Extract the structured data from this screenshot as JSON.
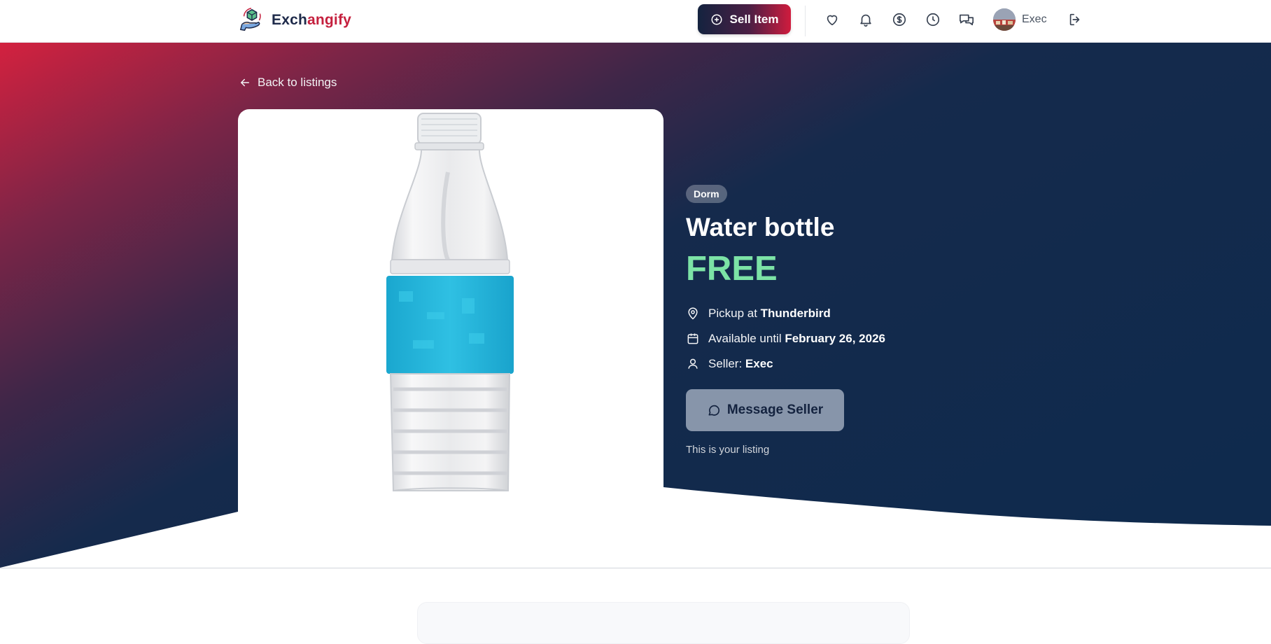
{
  "header": {
    "brand": {
      "part1": "Exch",
      "part2": "angify",
      "logo_icon": "hand-box-icon"
    },
    "sell_button": {
      "label": "Sell Item",
      "icon": "plus-circle-icon"
    },
    "nav_icons": [
      "heart-icon",
      "bell-icon",
      "dollar-icon",
      "clock-icon",
      "chat-icon"
    ],
    "user": {
      "name": "Exec"
    },
    "logout_icon": "logout-icon"
  },
  "back_link": {
    "label": "Back to listings",
    "icon": "arrow-left-icon"
  },
  "listing": {
    "category": "Dorm",
    "title": "Water bottle",
    "price": "FREE",
    "pickup_prefix": "Pickup at ",
    "pickup_location": "Thunderbird",
    "available_prefix": "Available until ",
    "available_date": "February 26, 2026",
    "seller_prefix": "Seller: ",
    "seller_name": "Exec",
    "message_button": "Message Seller",
    "note": "This is your listing"
  },
  "colors": {
    "brand_navy": "#14233f",
    "brand_red": "#c5203e",
    "price_green": "#7ce3a6",
    "message_button_bg": "#8795aa"
  }
}
